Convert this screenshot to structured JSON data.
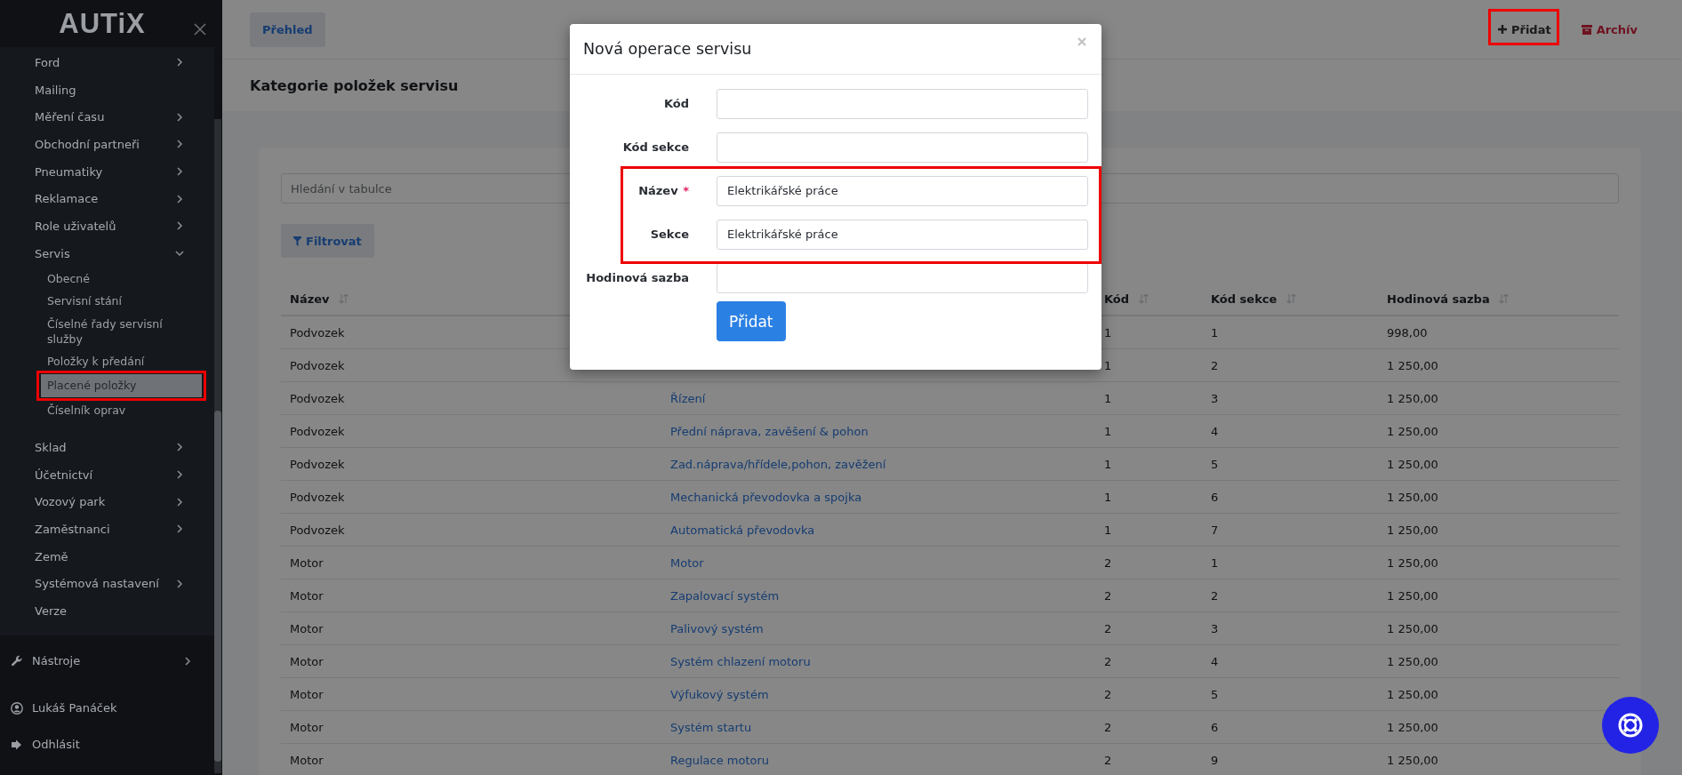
{
  "sidebar": {
    "logo": "AUTiX",
    "items": [
      {
        "label": "Ford",
        "kind": "group",
        "expanded": false
      },
      {
        "label": "Mailing",
        "kind": "link"
      },
      {
        "label": "Měření času",
        "kind": "group",
        "expanded": false
      },
      {
        "label": "Obchodní partneři",
        "kind": "group",
        "expanded": false
      },
      {
        "label": "Pneumatiky",
        "kind": "group",
        "expanded": false
      },
      {
        "label": "Reklamace",
        "kind": "group",
        "expanded": false
      },
      {
        "label": "Role uživatelů",
        "kind": "group",
        "expanded": false
      },
      {
        "label": "Servis",
        "kind": "group",
        "expanded": true,
        "children": [
          {
            "label": "Obecné",
            "selected": false
          },
          {
            "label": "Servisní stání",
            "selected": false
          },
          {
            "label": "Číselné řady servisní služby",
            "selected": false
          },
          {
            "label": "Položky k předání",
            "selected": false
          },
          {
            "label": "Placené položky",
            "selected": true
          },
          {
            "label": "Číselník oprav",
            "selected": false
          }
        ]
      },
      {
        "label": "Sklad",
        "kind": "group",
        "expanded": false
      },
      {
        "label": "Účetnictví",
        "kind": "group",
        "expanded": false
      },
      {
        "label": "Vozový park",
        "kind": "group",
        "expanded": false
      },
      {
        "label": "Zaměstnanci",
        "kind": "group",
        "expanded": false
      },
      {
        "label": "Země",
        "kind": "link"
      },
      {
        "label": "Systémová nastavení",
        "kind": "group",
        "expanded": false
      },
      {
        "label": "Verze",
        "kind": "link"
      }
    ],
    "tools": {
      "label": "Nástroje",
      "expanded": false
    },
    "user": "Lukáš Panáček",
    "logout": "Odhlásit"
  },
  "toolbar": {
    "overview": "Přehled",
    "add": "Přidat",
    "archive": "Archív"
  },
  "page_title": "Kategorie položek servisu",
  "search": {
    "placeholder": "Hledání v tabulce"
  },
  "filter_button": "Filtrovat",
  "table": {
    "headers": {
      "nazev": "Název",
      "kod": "Kód",
      "kod_sekce": "Kód sekce",
      "hodinova_sazba": "Hodinová sazba"
    },
    "rows": [
      {
        "nazev": "Podvozek",
        "kod": "1",
        "kod_sekce": "1",
        "hodinova_sazba": "998,00"
      },
      {
        "nazev": "Podvozek",
        "kod": "1",
        "kod_sekce": "2",
        "hodinova_sazba": "1 250,00"
      },
      {
        "nazev": "Podvozek",
        "column_2": "Řízení",
        "kod": "1",
        "kod_sekce": "3",
        "hodinova_sazba": "1 250,00"
      },
      {
        "nazev": "Podvozek",
        "column_2": "Přední náprava, zavěšení & pohon",
        "kod": "1",
        "kod_sekce": "4",
        "hodinova_sazba": "1 250,00"
      },
      {
        "nazev": "Podvozek",
        "column_2": "Zad.náprava/hřídele,pohon, zavěžení",
        "kod": "1",
        "kod_sekce": "5",
        "hodinova_sazba": "1 250,00"
      },
      {
        "nazev": "Podvozek",
        "column_2": "Mechanická převodovka a spojka",
        "kod": "1",
        "kod_sekce": "6",
        "hodinova_sazba": "1 250,00"
      },
      {
        "nazev": "Podvozek",
        "column_2": "Automatická převodovka",
        "kod": "1",
        "kod_sekce": "7",
        "hodinova_sazba": "1 250,00"
      },
      {
        "nazev": "Motor",
        "column_2": "Motor",
        "kod": "2",
        "kod_sekce": "1",
        "hodinova_sazba": "1 250,00"
      },
      {
        "nazev": "Motor",
        "column_2": "Zapalovací systém",
        "kod": "2",
        "kod_sekce": "2",
        "hodinova_sazba": "1 250,00"
      },
      {
        "nazev": "Motor",
        "column_2": "Palivový systém",
        "kod": "2",
        "kod_sekce": "3",
        "hodinova_sazba": "1 250,00"
      },
      {
        "nazev": "Motor",
        "column_2": "Systém chlazení motoru",
        "kod": "2",
        "kod_sekce": "4",
        "hodinova_sazba": "1 250,00"
      },
      {
        "nazev": "Motor",
        "column_2": "Výfukový systém",
        "kod": "2",
        "kod_sekce": "5",
        "hodinova_sazba": "1 250,00"
      },
      {
        "nazev": "Motor",
        "column_2": "Systém startu",
        "kod": "2",
        "kod_sekce": "6",
        "hodinova_sazba": "1 250,00"
      },
      {
        "nazev": "Motor",
        "column_2": "Regulace motoru",
        "kod": "2",
        "kod_sekce": "9",
        "hodinova_sazba": "1 250,00"
      }
    ]
  },
  "modal": {
    "title": "Nová operace servisu",
    "fields": [
      {
        "label": "Kód"
      },
      {
        "label": "Kód sekce"
      },
      {
        "label": "Název",
        "required_mark": "*",
        "value": "Elektrikářské práce"
      },
      {
        "label": "Sekce",
        "value": "Elektrikářské práce"
      },
      {
        "label": "Hodinová sazba"
      }
    ],
    "submit": "Přidat"
  }
}
